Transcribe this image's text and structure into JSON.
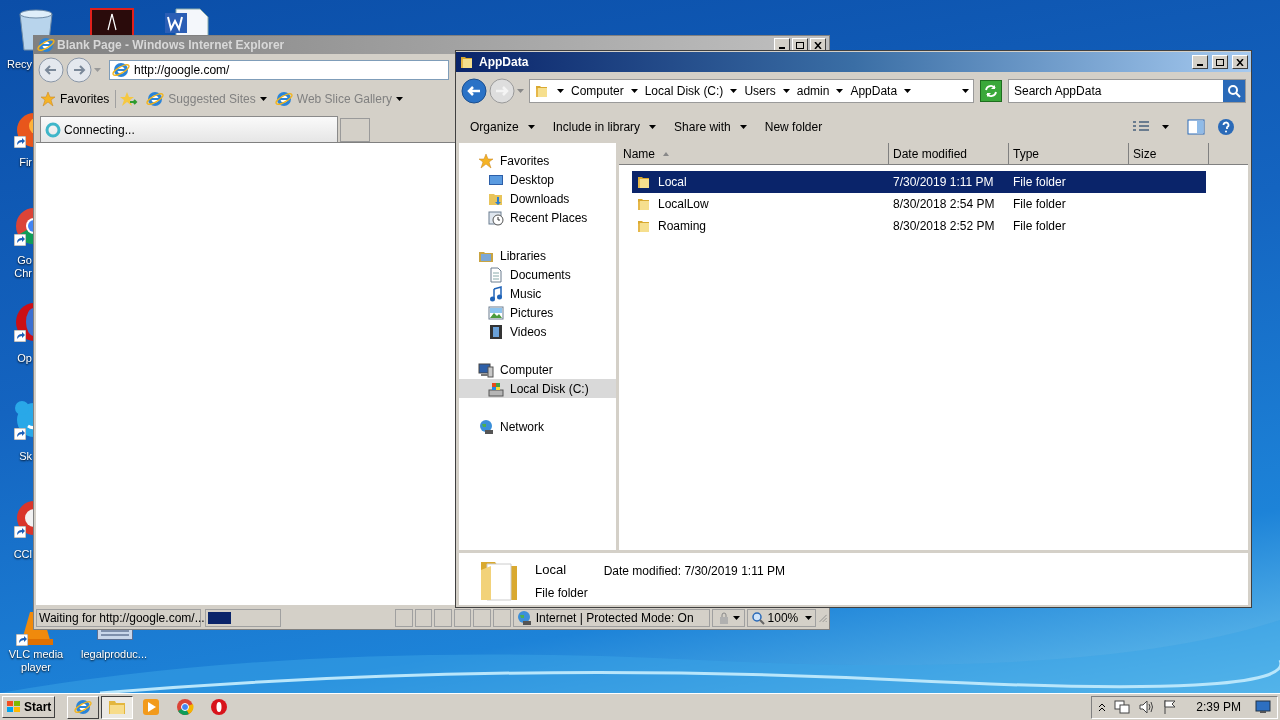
{
  "desktop_icons": [
    {
      "kind": "recycle",
      "label": "Recy"
    },
    {
      "kind": "acrobat"
    },
    {
      "kind": "word"
    },
    {
      "kind": "firefox",
      "label": "Fir"
    },
    {
      "kind": "chrome",
      "label": "Go Chr"
    },
    {
      "kind": "opera",
      "label": "Op"
    },
    {
      "kind": "skype",
      "label": "Sk"
    },
    {
      "kind": "ccleaner",
      "label": "CCl"
    },
    {
      "kind": "vlc",
      "label": "VLC media player"
    },
    {
      "kind": "document",
      "label": "legalproduc..."
    }
  ],
  "ie_window": {
    "title": "Blank Page - Windows Internet Explorer",
    "address": "http://google.com/",
    "favorites": "Favorites",
    "links": [
      "Suggested Sites",
      "Web Slice Gallery"
    ],
    "tab": "Connecting...",
    "status": {
      "text": "Waiting for http://google.com/...",
      "level": 0.33,
      "zone": "Internet | Protected Mode: On",
      "zoom": "100%"
    }
  },
  "explorer_window": {
    "title": "AppData",
    "breadcrumb": [
      "Computer",
      "Local Disk (C:)",
      "Users",
      "admin",
      "AppData"
    ],
    "search": {
      "placeholder": "Search AppData"
    },
    "toolbar": [
      {
        "label": "Organize",
        "dropdown": true
      },
      {
        "label": "Include in library",
        "dropdown": true
      },
      {
        "label": "Share with",
        "dropdown": true
      },
      {
        "label": "New folder",
        "dropdown": false
      }
    ],
    "navigation": [
      {
        "label": "Favorites",
        "kind": "star",
        "selected": false,
        "children": [
          {
            "label": "Desktop",
            "kind": "desktop",
            "selected": false
          },
          {
            "label": "Downloads",
            "kind": "downloads",
            "selected": false
          },
          {
            "label": "Recent Places",
            "kind": "recent",
            "selected": false
          }
        ]
      },
      {
        "label": "Libraries",
        "kind": "library",
        "selected": false,
        "children": [
          {
            "label": "Documents",
            "kind": "documents",
            "selected": false
          },
          {
            "label": "Music",
            "kind": "music",
            "selected": false
          },
          {
            "label": "Pictures",
            "kind": "pictures",
            "selected": false
          },
          {
            "label": "Videos",
            "kind": "videos",
            "selected": false
          }
        ]
      },
      {
        "label": "Computer",
        "kind": "computer",
        "selected": false,
        "children": [
          {
            "label": "Local Disk (C:)",
            "kind": "disk",
            "selected": true
          }
        ]
      },
      {
        "label": "Network",
        "kind": "network",
        "selected": false
      }
    ],
    "columns": [
      {
        "label": "Name",
        "sorted": true
      },
      {
        "label": "Date modified",
        "sorted": false
      },
      {
        "label": "Type",
        "sorted": false
      },
      {
        "label": "Size",
        "sorted": false
      }
    ],
    "rows": [
      {
        "name": "Local",
        "date": "7/30/2019 1:11 PM",
        "type": "File folder",
        "selected": true
      },
      {
        "name": "LocalLow",
        "date": "8/30/2018 2:54 PM",
        "type": "File folder",
        "selected": false
      },
      {
        "name": "Roaming",
        "date": "8/30/2018 2:52 PM",
        "type": "File folder",
        "selected": false
      }
    ],
    "details": {
      "name": "Local",
      "date_label": "Date modified:",
      "date": "7/30/2019 1:11 PM",
      "type": "File folder"
    }
  },
  "taskbar": {
    "start": "Start",
    "apps": [
      {
        "kind": "ie",
        "selected": false
      },
      {
        "kind": "explorer",
        "selected": true
      },
      {
        "kind": "media",
        "selected": false
      },
      {
        "kind": "chrome",
        "selected": false
      },
      {
        "kind": "opera",
        "selected": false
      }
    ],
    "clock": "2:39 PM"
  }
}
